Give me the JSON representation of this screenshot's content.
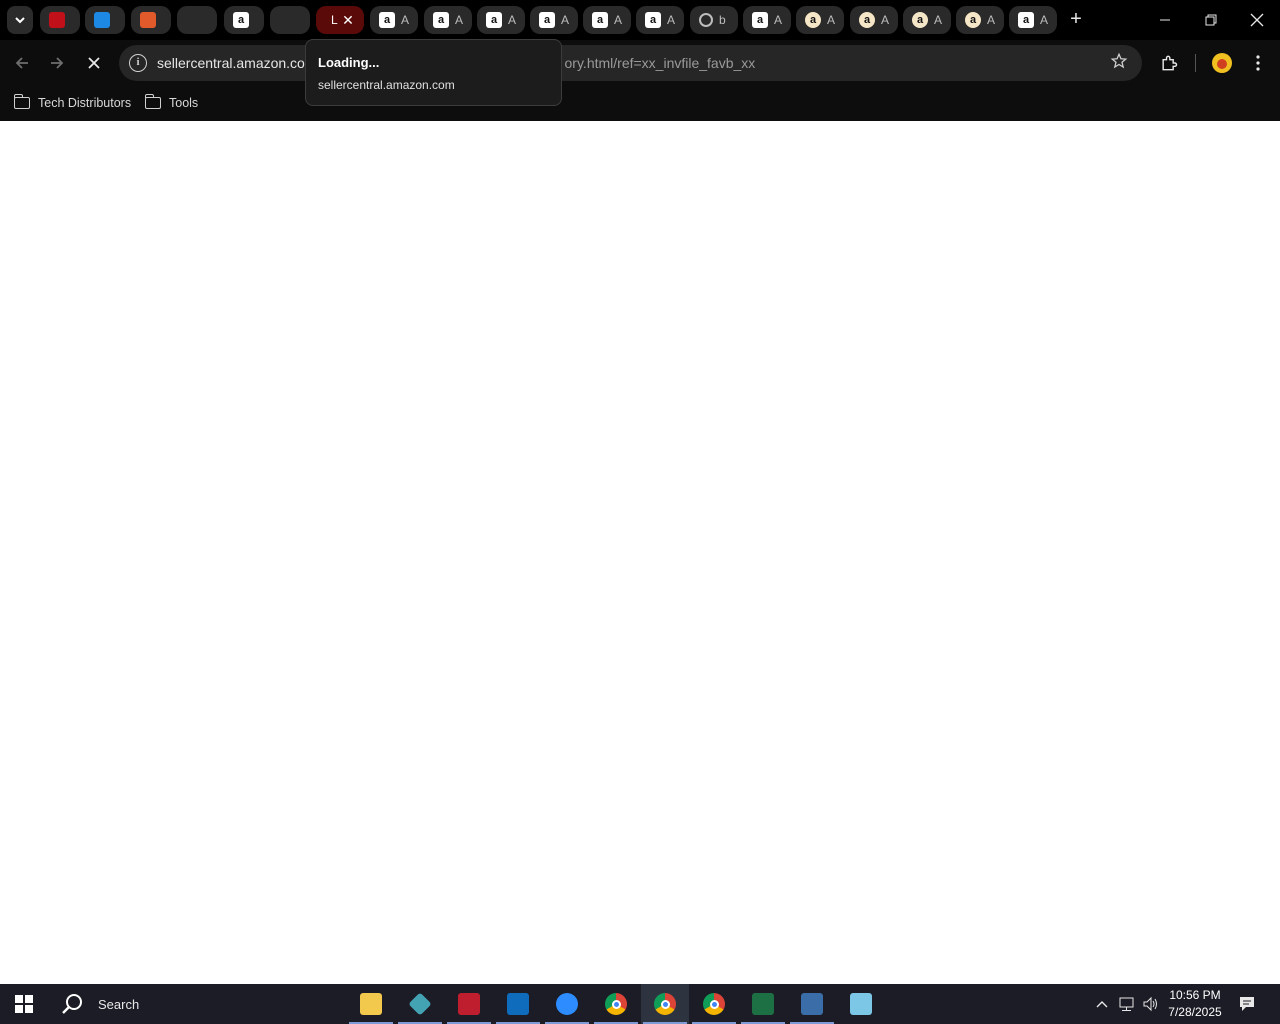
{
  "browser": {
    "tabs": [
      {
        "favicon": "dell-icon",
        "title": "",
        "color": "#c0101a"
      },
      {
        "favicon": "blue-square-icon",
        "title": "",
        "color": "#1e88e5"
      },
      {
        "favicon": "box-icon",
        "title": "",
        "color": "#e05a2b"
      },
      {
        "favicon": "ec-icon",
        "title": "",
        "color": "#1aa3d9"
      },
      {
        "favicon": "amazon-icon",
        "title": "",
        "color": "#111111"
      },
      {
        "favicon": "blank-icon",
        "title": "",
        "color": "#2a2a2a"
      },
      {
        "favicon": "loading-icon",
        "title": "L",
        "active": true
      },
      {
        "favicon": "amazon-icon",
        "title": "A"
      },
      {
        "favicon": "amazon-icon",
        "title": "A"
      },
      {
        "favicon": "amazon-icon",
        "title": "A"
      },
      {
        "favicon": "amazon-icon",
        "title": "A"
      },
      {
        "favicon": "amazon-icon",
        "title": "A"
      },
      {
        "favicon": "amazon-icon",
        "title": "A"
      },
      {
        "favicon": "globe-icon",
        "title": "b"
      },
      {
        "favicon": "amazon-icon",
        "title": "A"
      },
      {
        "favicon": "amazon-round-icon",
        "title": "A"
      },
      {
        "favicon": "amazon-round-icon",
        "title": "A"
      },
      {
        "favicon": "amazon-round-icon",
        "title": "A"
      },
      {
        "favicon": "amazon-round-icon",
        "title": "A"
      },
      {
        "favicon": "amazon-icon",
        "title": "A"
      }
    ],
    "close_glyph": "✕",
    "new_tab_glyph": "+",
    "url_host": "sellercentral.amazon.cor",
    "url_rest": "ory.html/ref=xx_invfile_favb_xx",
    "bookmarks": [
      {
        "label": "Tech Distributors"
      },
      {
        "label": "Tools"
      }
    ],
    "hovercard": {
      "title": "Loading...",
      "subtitle": "sellercentral.amazon.com"
    }
  },
  "taskbar": {
    "search_label": "Search",
    "apps": [
      {
        "name": "file-explorer",
        "icon": "folder-icon",
        "color": "#f2c94c"
      },
      {
        "name": "app-diamond",
        "icon": "diamond-icon",
        "color": "#44a3b3"
      },
      {
        "name": "filezilla",
        "icon": "filezilla-icon",
        "color": "#bf1e2e"
      },
      {
        "name": "outlook",
        "icon": "outlook-icon",
        "color": "#0f6cbd"
      },
      {
        "name": "zoom",
        "icon": "zoom-icon",
        "color": "#2d8cff"
      },
      {
        "name": "chrome-1",
        "icon": "chrome-icon"
      },
      {
        "name": "chrome-2",
        "icon": "chrome-icon",
        "focused": true
      },
      {
        "name": "chrome-3",
        "icon": "chrome-icon"
      },
      {
        "name": "excel",
        "icon": "excel-icon",
        "color": "#1d7044"
      },
      {
        "name": "calculator",
        "icon": "calculator-icon",
        "color": "#3b6ea8"
      },
      {
        "name": "notes",
        "icon": "notes-icon",
        "color": "#7cc6e6"
      }
    ],
    "time": "10:56 PM",
    "date": "7/28/2025"
  }
}
